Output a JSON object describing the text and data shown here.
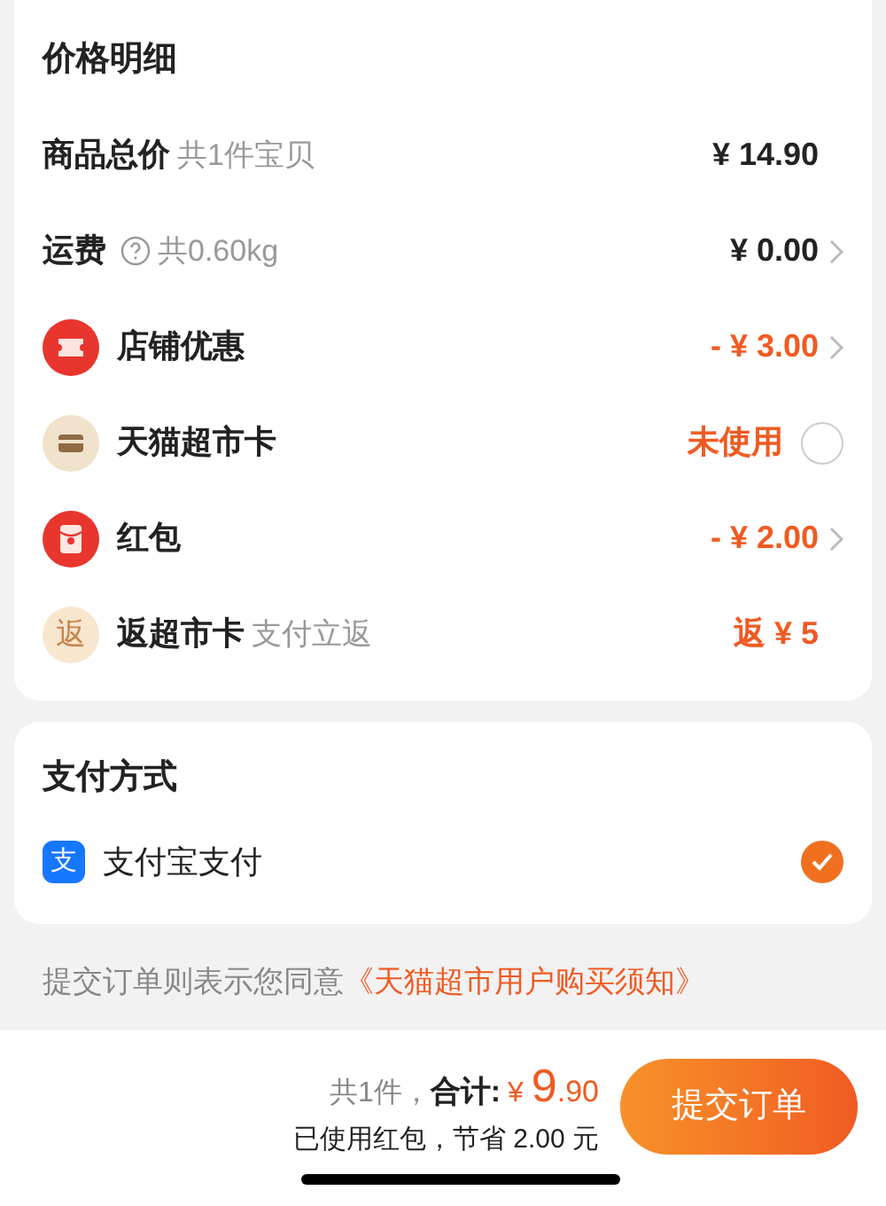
{
  "price_detail": {
    "title": "价格明细",
    "rows": [
      {
        "kind": "subtotal",
        "label": "商品总价",
        "note": "共1件宝贝",
        "value": "¥ 14.90",
        "highlight": false,
        "expandable": false
      },
      {
        "kind": "shipping",
        "label": "运费",
        "note": "共0.60kg",
        "value": "¥ 0.00",
        "highlight": false,
        "expandable": true
      },
      {
        "kind": "coupon",
        "label": "店铺优惠",
        "value": "- ¥ 3.00",
        "highlight": true,
        "expandable": true
      },
      {
        "kind": "card",
        "label": "天猫超市卡",
        "value": "未使用",
        "highlight": true,
        "checked": false
      },
      {
        "kind": "redpacket",
        "label": "红包",
        "value": "- ¥ 2.00",
        "highlight": true,
        "expandable": true
      },
      {
        "kind": "rebate",
        "label": "返超市卡",
        "note": "支付立返",
        "value": "返 ¥ 5",
        "highlight": true,
        "expandable": false,
        "badge": "返"
      }
    ]
  },
  "payment": {
    "title": "支付方式",
    "methods": [
      {
        "label": "支付宝支付",
        "selected": true,
        "badge": "支"
      }
    ]
  },
  "agreement": {
    "text": "提交订单则表示您同意",
    "link": "《天猫超市用户购买须知》"
  },
  "footer": {
    "count": "共1件，",
    "total_label": "合计:",
    "currency": "¥",
    "integer": "9",
    "decimal": ".90",
    "saving": "已使用红包，节省 2.00 元",
    "submit": "提交订单"
  }
}
